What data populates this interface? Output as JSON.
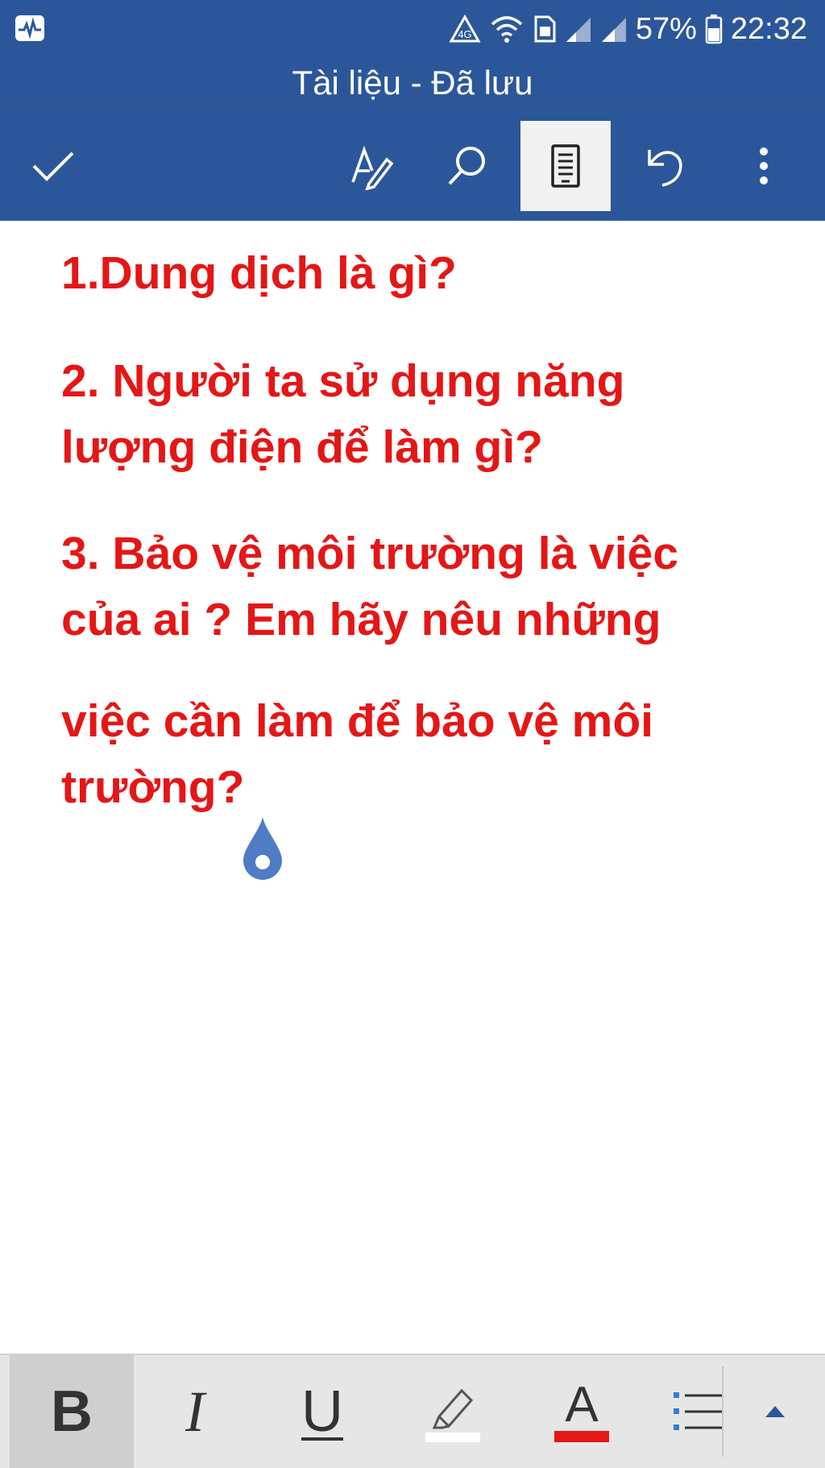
{
  "status": {
    "battery_percent": "57%",
    "time": "22:32"
  },
  "document": {
    "title": "Tài liệu - Đã lưu",
    "paragraphs": [
      {
        "lines": [
          "1.Dung dịch là gì?"
        ]
      },
      {
        "lines": [
          "2. Người ta sử dụng năng",
          "lượng điện để làm gì?"
        ]
      },
      {
        "lines": [
          "3. Bảo vệ môi trường là việc",
          "của ai ? Em hãy nêu những"
        ]
      },
      {
        "lines": [
          "việc cần làm để bảo vệ môi",
          "trường?"
        ]
      }
    ]
  },
  "format": {
    "bold_label": "B",
    "italic_label": "I",
    "underline_label": "U",
    "font_color_label": "A"
  },
  "icons": {
    "done": "checkmark-icon",
    "draw": "pen-draw-icon",
    "search": "search-icon",
    "view": "mobile-view-icon",
    "undo": "undo-icon",
    "more": "more-vertical-icon",
    "highlight": "highlighter-icon",
    "list": "bullet-list-icon",
    "expand": "triangle-up-icon"
  },
  "colors": {
    "header": "#2b579a",
    "text_red": "#e51616",
    "font_color_bar": "#e51616",
    "highlight_bar": "#ffffff",
    "handle": "#4f7cc4"
  }
}
